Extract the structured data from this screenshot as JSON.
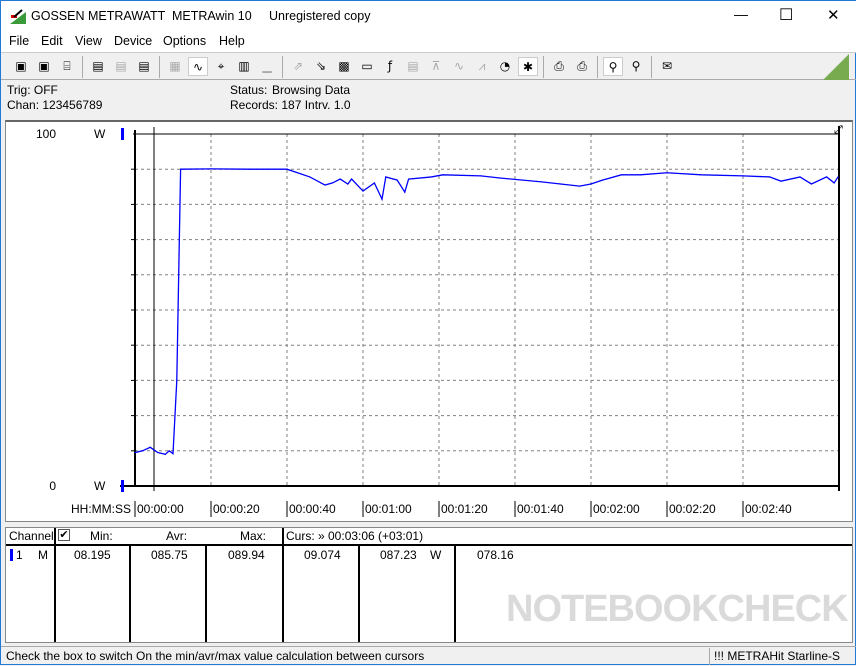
{
  "window": {
    "brand": "GOSSEN METRAWATT",
    "app": "METRAwin 10",
    "license": "Unregistered copy",
    "controls": {
      "minimize": "—",
      "maximize": "☐",
      "close": "✕"
    }
  },
  "menu": [
    "File",
    "Edit",
    "View",
    "Device",
    "Options",
    "Help"
  ],
  "toolbar": [
    {
      "icon": "save-icon",
      "glyph": "▣"
    },
    {
      "icon": "save-as-icon",
      "glyph": "▣"
    },
    {
      "icon": "open-folder-icon",
      "glyph": "⌸"
    },
    {
      "icon": "device-read-icon",
      "glyph": "▤"
    },
    {
      "icon": "device-transfer-icon",
      "glyph": "▤",
      "disabled": true
    },
    {
      "icon": "device-memory-icon",
      "glyph": "▤"
    },
    {
      "icon": "digital-display-icon",
      "glyph": "▦",
      "disabled": true
    },
    {
      "icon": "waveform-view-icon",
      "glyph": "∿",
      "active": true
    },
    {
      "icon": "crosshair-icon",
      "glyph": "⌖"
    },
    {
      "icon": "table-view-icon",
      "glyph": "▥"
    },
    {
      "icon": "histogram-icon",
      "glyph": "▁",
      "disabled": true
    },
    {
      "icon": "export-icon",
      "glyph": "⇗",
      "disabled": true
    },
    {
      "icon": "import-icon",
      "glyph": "⇘"
    },
    {
      "icon": "binary-data-icon",
      "glyph": "▩"
    },
    {
      "icon": "monitor-icon",
      "glyph": "▭"
    },
    {
      "icon": "function-icon",
      "glyph": "ƒ"
    },
    {
      "icon": "device-config-icon",
      "glyph": "▤",
      "disabled": true
    },
    {
      "icon": "trigger-icon",
      "glyph": "⊼",
      "disabled": true
    },
    {
      "icon": "signal-icon",
      "glyph": "∿",
      "disabled": true
    },
    {
      "icon": "sampling-icon",
      "glyph": "⩘",
      "disabled": true
    },
    {
      "icon": "timer-icon",
      "glyph": "◔"
    },
    {
      "icon": "bug-icon",
      "glyph": "✱",
      "active": true
    },
    {
      "icon": "print-icon",
      "glyph": "⎙"
    },
    {
      "icon": "print-setup-icon",
      "glyph": "⎙"
    },
    {
      "icon": "zoom-wave-icon",
      "glyph": "⚲",
      "active": true
    },
    {
      "icon": "zoom-out-icon",
      "glyph": "⚲"
    },
    {
      "icon": "comment-icon",
      "glyph": "✉"
    }
  ],
  "info": {
    "trig": "Trig: OFF",
    "chan": "Chan:  123456789",
    "status_label": "Status:",
    "status_value": "Browsing Data",
    "records": "Records: 187   Intrv. 1.0"
  },
  "colors": {
    "trace": "#0000ff",
    "grid": "#808080",
    "logo_green": "#78aa50"
  },
  "chart_data": {
    "type": "line",
    "ylabel_top": "100",
    "ylabel_bottom": "0",
    "yunit": "W",
    "ylim": [
      0,
      100
    ],
    "y_grid_step": 10,
    "xlabel": "HH:MM:SS",
    "xticks": [
      "00:00:00",
      "00:00:20",
      "00:00:40",
      "00:01:00",
      "00:01:20",
      "00:01:40",
      "00:02:00",
      "00:02:20",
      "00:02:40"
    ],
    "xlim": [
      "00:00:00",
      "00:03:05"
    ],
    "cursor": "00:00:05",
    "grid": true,
    "series": [
      {
        "x": [
          "00:00:00",
          "00:00:02",
          "00:00:04",
          "00:00:06",
          "00:00:08",
          "00:00:09",
          "00:00:10",
          "00:00:11",
          "00:00:12",
          "00:00:20",
          "00:00:30",
          "00:00:40",
          "00:00:46",
          "00:00:50",
          "00:00:52",
          "00:00:54",
          "00:00:56",
          "00:00:57",
          "00:01:00",
          "00:01:03",
          "00:01:05",
          "00:01:06",
          "00:01:09",
          "00:01:11",
          "00:01:12",
          "00:01:18",
          "00:01:21",
          "00:01:31",
          "00:01:36",
          "00:01:47",
          "00:01:52",
          "00:01:57",
          "00:02:00",
          "00:02:03",
          "00:02:08",
          "00:02:13",
          "00:02:20",
          "00:02:29",
          "00:02:40",
          "00:02:47",
          "00:02:50",
          "00:02:55",
          "00:02:58",
          "00:03:02",
          "00:03:04",
          "00:03:05"
        ],
        "y": [
          9.5,
          10.0,
          11.0,
          9.5,
          9.0,
          10.0,
          9.2,
          30,
          90.0,
          90.1,
          90.0,
          90.0,
          87.8,
          85.5,
          86.1,
          87.2,
          85.8,
          87.2,
          83.8,
          86.1,
          81.5,
          87.8,
          86.9,
          83.5,
          87.2,
          87.8,
          88.4,
          88.1,
          87.5,
          86.4,
          85.8,
          85.2,
          85.8,
          86.9,
          88.4,
          88.4,
          89.0,
          88.4,
          88.1,
          87.8,
          86.6,
          87.8,
          85.8,
          87.8,
          86.1,
          87.8
        ]
      }
    ]
  },
  "table": {
    "headers": {
      "channel": "Channel:",
      "min": "Min:",
      "avr": "Avr:",
      "max": "Max:",
      "curs": "Curs: » 00:03:06 (+03:01)"
    },
    "checkbox_checked": true,
    "rows": [
      {
        "num": "1",
        "type": "M",
        "min": "08.195",
        "avr": "085.75",
        "max": "089.94",
        "c1": "09.074",
        "c2": "087.23",
        "unit": "W",
        "c3": "078.16"
      }
    ]
  },
  "watermark": "NOTEBOOKCHECK",
  "statusbar": {
    "message": "Check the box to switch On the min/avr/max value calculation between cursors",
    "device": "!!! METRAHit Starline-S"
  }
}
